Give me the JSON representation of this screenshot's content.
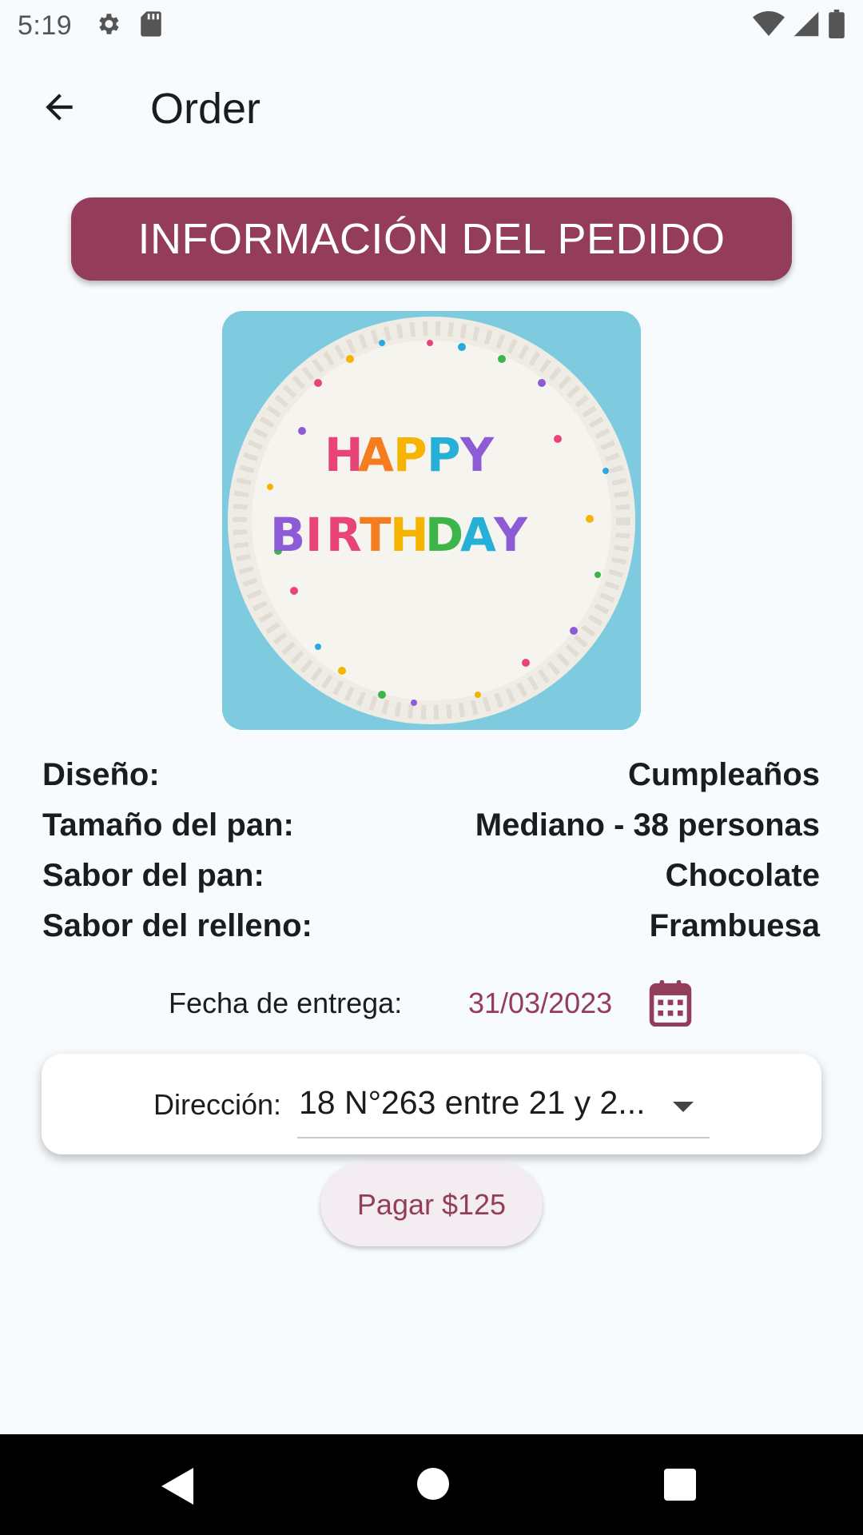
{
  "status_bar": {
    "time": "5:19",
    "icons": [
      "gear-icon",
      "sd-card-icon",
      "wifi-icon",
      "signal-icon",
      "battery-icon"
    ]
  },
  "app_bar": {
    "title": "Order",
    "back_icon": "arrow-back-icon"
  },
  "banner": {
    "title": "INFORMACIÓN DEL PEDIDO",
    "color": "#943d5b"
  },
  "cake_image": {
    "lettering": "HAPPY BIRTHDAY"
  },
  "details": [
    {
      "label": "Diseño:",
      "value": "Cumpleaños"
    },
    {
      "label": "Tamaño del pan:",
      "value": "Mediano - 38 personas"
    },
    {
      "label": "Sabor del pan:",
      "value": "Chocolate"
    },
    {
      "label": "Sabor del relleno:",
      "value": "Frambuesa"
    }
  ],
  "delivery": {
    "label": "Fecha de entrega:",
    "date": "31/03/2023",
    "icon": "calendar-icon"
  },
  "address": {
    "label": "Dirección:",
    "value": "18 N°263 entre 21 y 2...",
    "icon": "chevron-down-icon"
  },
  "pay_button": {
    "label": "Pagar $125"
  },
  "nav_bar": {
    "icons": [
      "nav-back-icon",
      "nav-home-icon",
      "nav-recents-icon"
    ]
  },
  "colors": {
    "accent": "#943d5b",
    "background": "#f8fbfd"
  }
}
